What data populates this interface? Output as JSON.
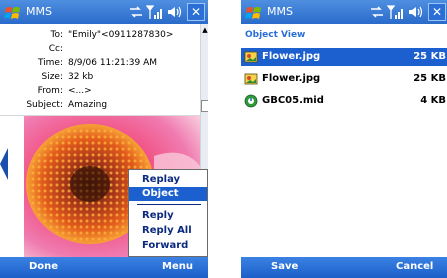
{
  "left_screen": {
    "app_title": "MMS",
    "header": [
      {
        "label": "To:",
        "value": "\"Emily\"<0911287830>"
      },
      {
        "label": "Cc:",
        "value": ""
      },
      {
        "label": "Time:",
        "value": "8/9/06 11:21:39 AM"
      },
      {
        "label": "Size:",
        "value": "32 kb"
      },
      {
        "label": "From:",
        "value": "<...>"
      },
      {
        "label": "Subject:",
        "value": "Amazing"
      }
    ],
    "menu": {
      "items": [
        "Replay",
        "Object View",
        "Reply",
        "Reply All",
        "Forward"
      ],
      "selected": "Object View"
    },
    "softkeys": {
      "left": "Done",
      "right": "Menu"
    }
  },
  "right_screen": {
    "app_title": "MMS",
    "section_title": "Object View",
    "files": [
      {
        "name": "Flower.jpg",
        "size": "25 KB",
        "icon": "image-file-icon"
      },
      {
        "name": "Flower.jpg",
        "size": "25 KB",
        "icon": "image-file-icon"
      },
      {
        "name": "GBC05.mid",
        "size": "4 KB",
        "icon": "audio-file-icon"
      }
    ],
    "softkeys": {
      "left": "Save",
      "right": "Cancel"
    }
  },
  "colors": {
    "titlebar": "#2a6bcb",
    "softbar": "#1b5fc8",
    "selection": "#1c5fce",
    "menu_text": "#0b2a80",
    "section_title": "#2b6fd6"
  }
}
